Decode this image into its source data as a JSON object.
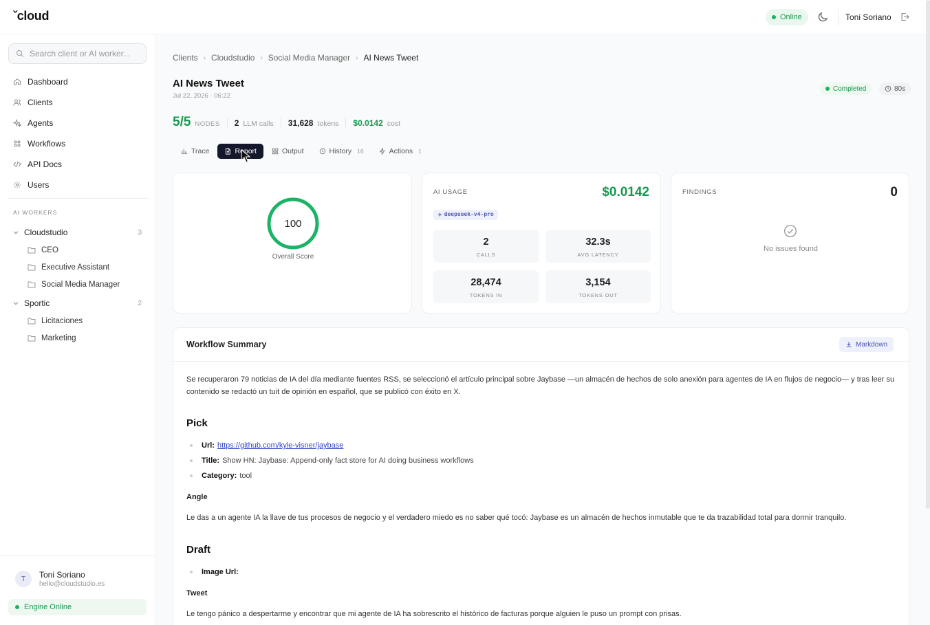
{
  "app": {
    "logo": "ˇcloud"
  },
  "topbar": {
    "status": "Online",
    "user_name": "Toni Soriano"
  },
  "sidebar": {
    "search_placeholder": "Search client or AI worker...",
    "nav": [
      {
        "label": "Dashboard",
        "icon": "home-icon"
      },
      {
        "label": "Clients",
        "icon": "users-icon"
      },
      {
        "label": "Agents",
        "icon": "sparkles-icon"
      },
      {
        "label": "Workflows",
        "icon": "grid-icon"
      },
      {
        "label": "API Docs",
        "icon": "code-icon"
      },
      {
        "label": "Users",
        "icon": "gear-icon"
      }
    ],
    "section_label": "AI WORKERS",
    "groups": [
      {
        "name": "Cloudstudio",
        "count": "3",
        "items": [
          "CEO",
          "Executive Assistant",
          "Social Media Manager"
        ]
      },
      {
        "name": "Sportic",
        "count": "2",
        "items": [
          "Licitaciones",
          "Marketing"
        ]
      }
    ],
    "user": {
      "initial": "T",
      "name": "Toni Soriano",
      "email": "hello@cloudstudio.es"
    },
    "engine_status": "Engine Online"
  },
  "breadcrumb": [
    "Clients",
    "Cloudstudio",
    "Social Media Manager",
    "AI News Tweet"
  ],
  "run": {
    "title": "AI News Tweet",
    "date": "Jul 22, 2026 · 06:22",
    "status": "Completed",
    "duration": "80s",
    "nodes": "5/5",
    "nodes_label": "NODES",
    "llm_calls": "2",
    "llm_calls_label": "LLM calls",
    "tokens": "31,628",
    "tokens_label": "tokens",
    "cost": "$0.0142",
    "cost_label": "cost"
  },
  "tabs": [
    {
      "label": "Trace",
      "icon": "chart-icon",
      "count": ""
    },
    {
      "label": "Report",
      "icon": "document-icon",
      "count": "",
      "active": true
    },
    {
      "label": "Output",
      "icon": "grid-icon",
      "count": ""
    },
    {
      "label": "History",
      "icon": "clock-icon",
      "count": "16"
    },
    {
      "label": "Actions",
      "icon": "bolt-icon",
      "count": "1"
    }
  ],
  "score": {
    "value": "100",
    "label": "Overall Score",
    "fraction": 1.0
  },
  "usage": {
    "title": "AI USAGE",
    "cost": "$0.0142",
    "model": "deepseek-v4-pro",
    "metrics": [
      {
        "value": "2",
        "label": "CALLS"
      },
      {
        "value": "32.3s",
        "label": "AVG LATENCY"
      },
      {
        "value": "28,474",
        "label": "TOKENS IN"
      },
      {
        "value": "3,154",
        "label": "TOKENS OUT"
      }
    ]
  },
  "findings": {
    "title": "FINDINGS",
    "count": "0",
    "empty_text": "No issues found"
  },
  "summary": {
    "title": "Workflow Summary",
    "download_label": "Markdown",
    "intro": "Se recuperaron 79 noticias de IA del día mediante fuentes RSS, se seleccionó el artículo principal sobre Jaybase —un almacén de hechos de solo anexión para agentes de IA en flujos de negocio— y tras leer su contenido se redactó un tuit de opinión en español, que se publicó con éxito en X.",
    "pick_heading": "Pick",
    "pick_items": [
      {
        "key": "Url:",
        "value": "https://github.com/kyle-visner/jaybase"
      },
      {
        "key": "Title:",
        "value": "Show HN: Jaybase: Append-only fact store for AI doing business workflows"
      },
      {
        "key": "Category:",
        "value": "tool"
      }
    ],
    "angle_heading": "Angle",
    "angle_text": "Le das a un agente IA la llave de tus procesos de negocio y el verdadero miedo es no saber qué tocó: Jaybase es un almacén de hechos inmutable que te da trazabilidad total para dormir tranquilo.",
    "draft_heading": "Draft",
    "draft_items": [
      {
        "key": "Image Url:",
        "value": ""
      }
    ],
    "tweet_heading": "Tweet",
    "tweet_text": "Le tengo pánico a despertarme y encontrar que mi agente de IA ha sobrescrito el histórico de facturas porque alguien le puso un prompt con prisas."
  },
  "colors": {
    "accent_green": "#16994f",
    "active_tab": "#15182a",
    "model_badge": "#4a55b0"
  }
}
